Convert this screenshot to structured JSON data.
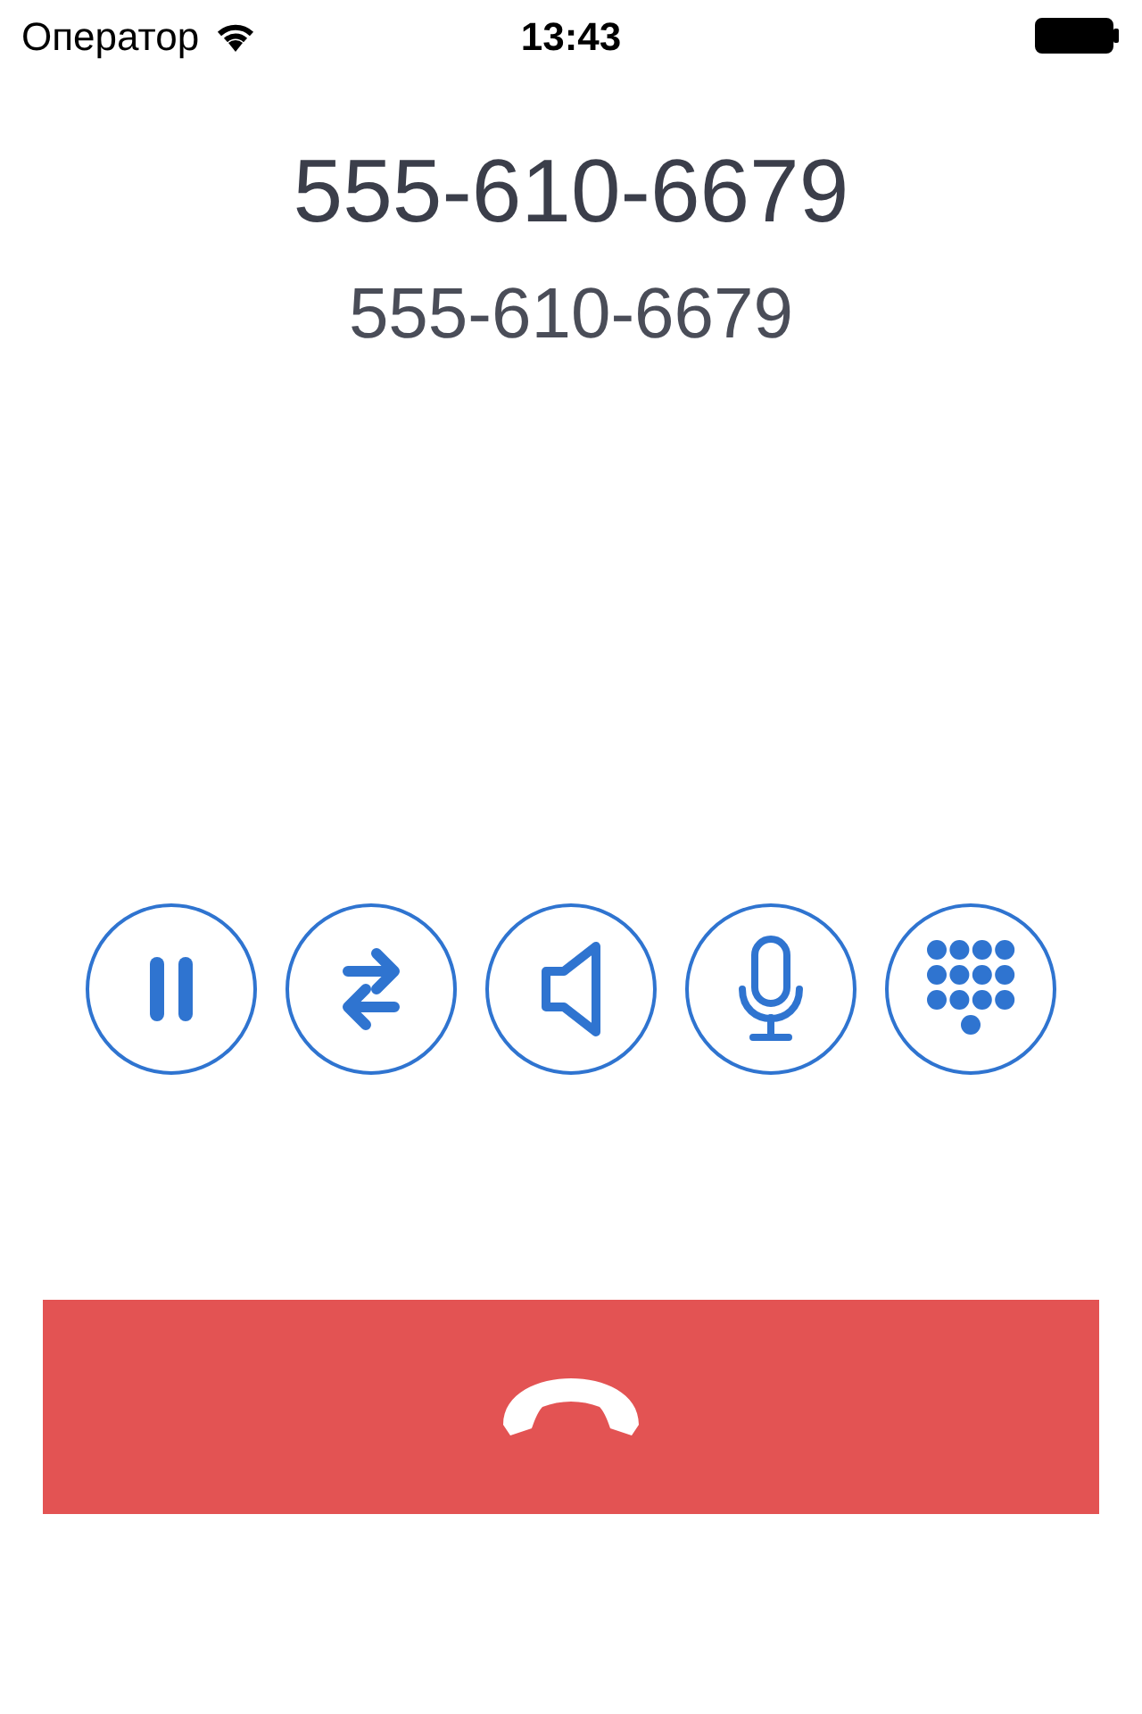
{
  "status_bar": {
    "carrier": "Оператор",
    "time": "13:43"
  },
  "caller": {
    "name": "555-610-6679",
    "number": "555-610-6679"
  },
  "controls": [
    {
      "kind": "hold"
    },
    {
      "kind": "transfer"
    },
    {
      "kind": "speaker"
    },
    {
      "kind": "mute"
    },
    {
      "kind": "keypad"
    }
  ],
  "end_call": {
    "kind": "hangup"
  }
}
